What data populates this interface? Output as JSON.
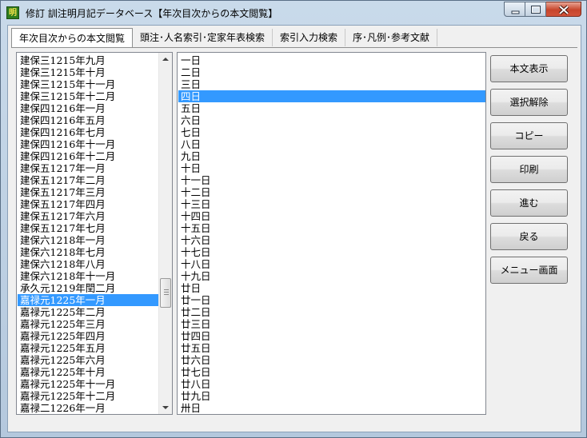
{
  "window": {
    "app_icon_text": "明",
    "title": "修訂 訓注明月記データベース【年次目次からの本文閲覧】"
  },
  "tabs": [
    {
      "label": "年次目次からの本文閲覧"
    },
    {
      "label": "頭注･人名索引･定家年表検索"
    },
    {
      "label": "索引入力検索"
    },
    {
      "label": "序･凡例･参考文献"
    }
  ],
  "left_list": {
    "items": [
      "建保三1215年九月",
      "建保三1215年十月",
      "建保三1215年十一月",
      "建保三1215年十二月",
      "建保四1216年一月",
      "建保四1216年五月",
      "建保四1216年七月",
      "建保四1216年十一月",
      "建保四1216年十二月",
      "建保五1217年一月",
      "建保五1217年二月",
      "建保五1217年三月",
      "建保五1217年四月",
      "建保五1217年六月",
      "建保五1217年七月",
      "建保六1218年一月",
      "建保六1218年七月",
      "建保六1218年八月",
      "建保六1218年十一月",
      "承久元1219年閏二月",
      "嘉禄元1225年一月",
      "嘉禄元1225年二月",
      "嘉禄元1225年三月",
      "嘉禄元1225年四月",
      "嘉禄元1225年五月",
      "嘉禄元1225年六月",
      "嘉禄元1225年十月",
      "嘉禄元1225年十一月",
      "嘉禄元1225年十二月",
      "嘉禄二1226年一月"
    ]
  },
  "right_list": {
    "items": [
      "一日",
      "二日",
      "三日",
      "四日",
      "五日",
      "六日",
      "七日",
      "八日",
      "九日",
      "十日",
      "十一日",
      "十二日",
      "十三日",
      "十四日",
      "十五日",
      "十六日",
      "十七日",
      "十八日",
      "十九日",
      "廿日",
      "廿一日",
      "廿二日",
      "廿三日",
      "廿四日",
      "廿五日",
      "廿六日",
      "廿七日",
      "廿八日",
      "廿九日",
      "卅日"
    ]
  },
  "buttons": {
    "show_text": "本文表示",
    "deselect": "選択解除",
    "copy": "コピー",
    "print": "印刷",
    "forward": "進む",
    "back": "戻る",
    "menu": "メニュー画面"
  }
}
